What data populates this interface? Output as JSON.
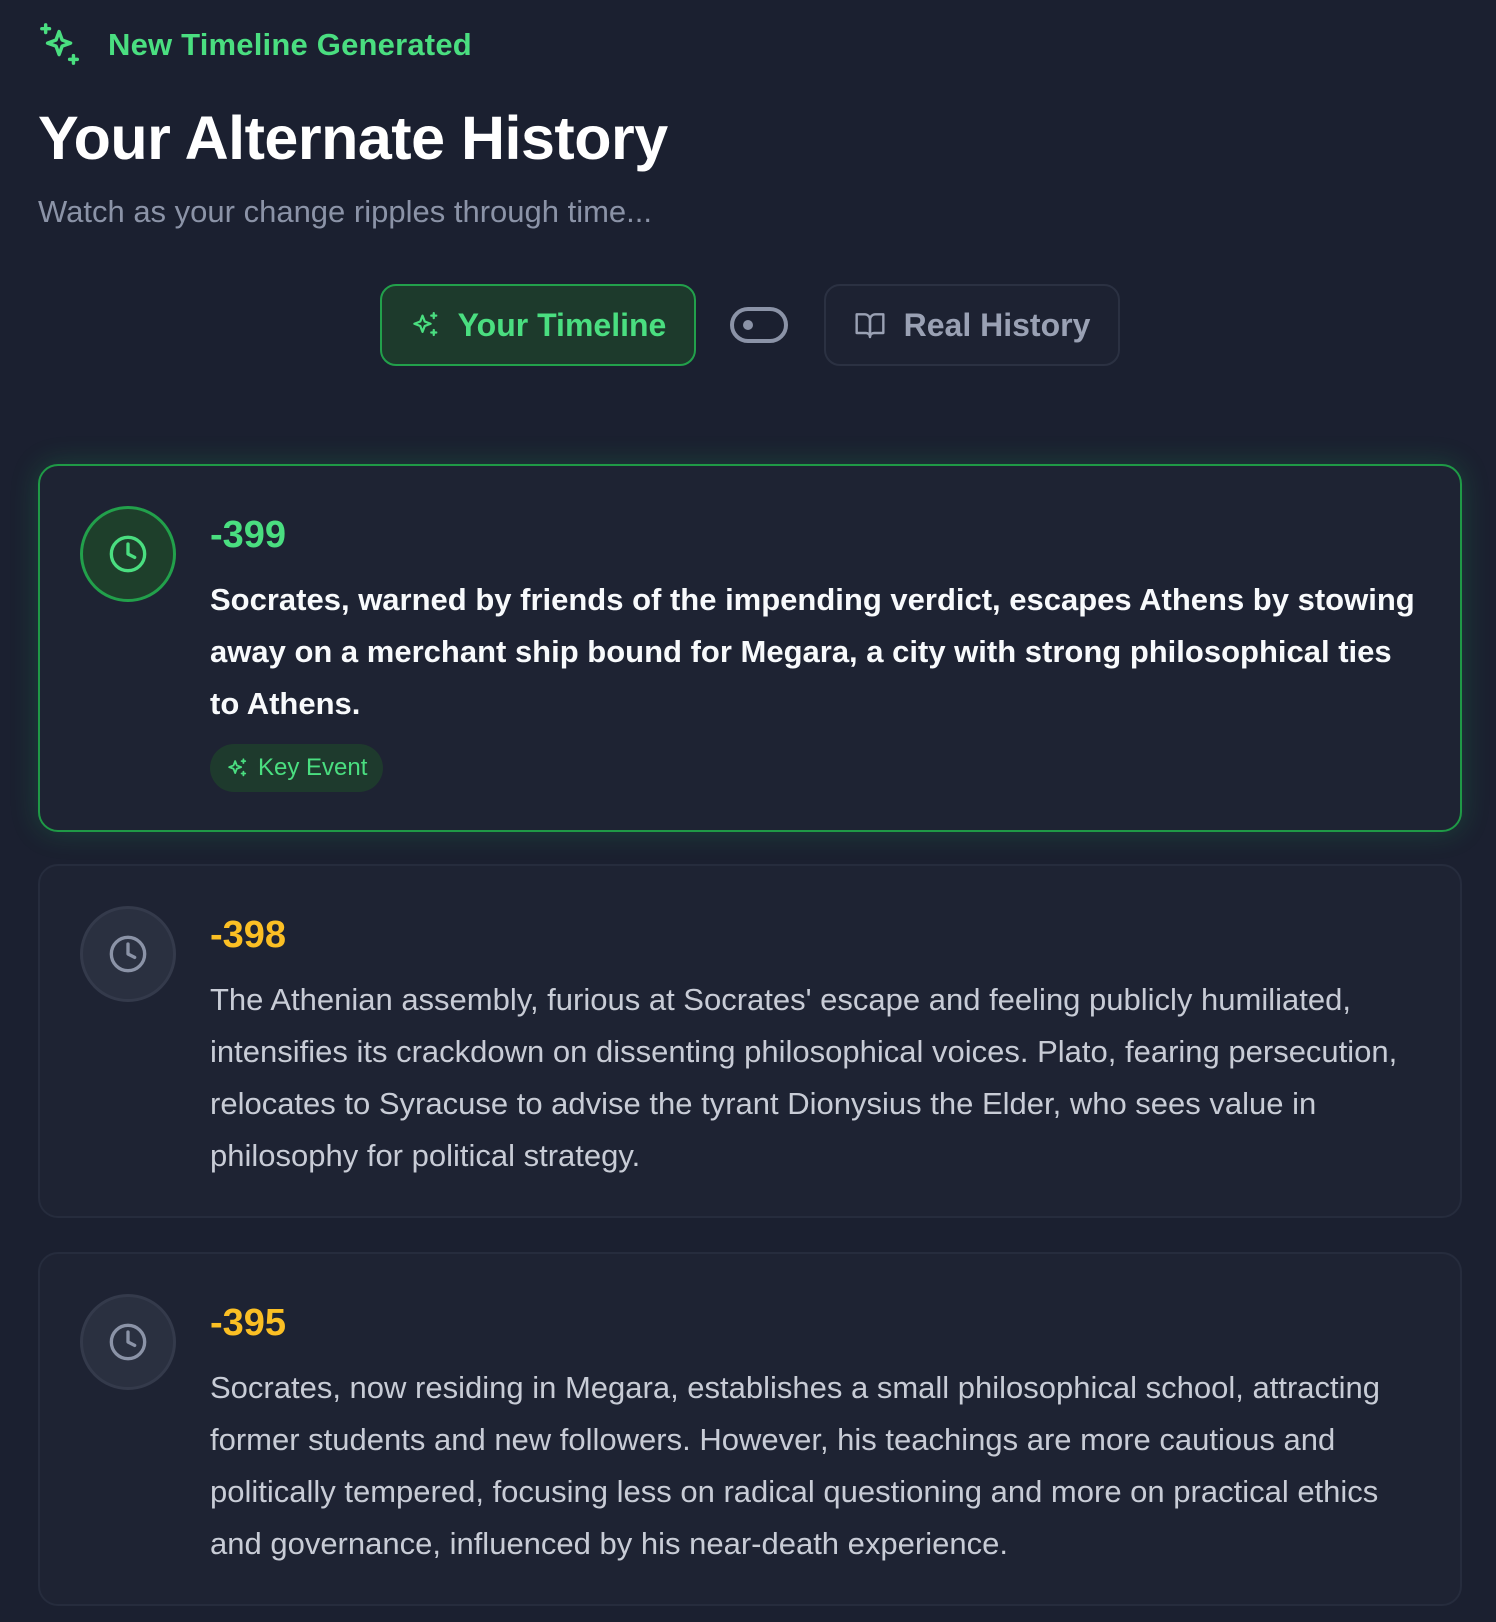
{
  "header": {
    "badge_label": "New Timeline Generated",
    "badge_icon": "sparkles-icon",
    "title": "Your Alternate History",
    "subtitle": "Watch as your change ripples through time..."
  },
  "toggle": {
    "your_timeline_label": "Your Timeline",
    "your_timeline_icon": "sparkles-icon",
    "switch_icon": "toggle-icon",
    "real_history_label": "Real History",
    "real_history_icon": "book-open-icon",
    "active": "your_timeline"
  },
  "events": [
    {
      "year": "-399",
      "icon": "clock-icon",
      "description": "Socrates, warned by friends of the impending verdict, escapes Athens by stowing away on a merchant ship bound for Megara, a city with strong philosophical ties to Athens.",
      "tag": "Key Event",
      "key_event": true
    },
    {
      "year": "-398",
      "icon": "clock-icon",
      "description": "The Athenian assembly, furious at Socrates' escape and feeling publicly humiliated, intensifies its crackdown on dissenting philosophical voices. Plato, fearing persecution, relocates to Syracuse to advise the tyrant Dionysius the Elder, who sees value in philosophy for political strategy.",
      "key_event": false
    },
    {
      "year": "-395",
      "icon": "clock-icon",
      "description": "Socrates, now residing in Megara, establishes a small philosophical school, attracting former students and new followers. However, his teachings are more cautious and politically tempered, focusing less on radical questioning and more on practical ethics and governance, influenced by his near-death experience.",
      "key_event": false
    }
  ],
  "colors": {
    "background": "#1b2030",
    "accent_green": "#4ade80",
    "year_amber": "#fbbf24",
    "card_background": "#1e2333"
  }
}
